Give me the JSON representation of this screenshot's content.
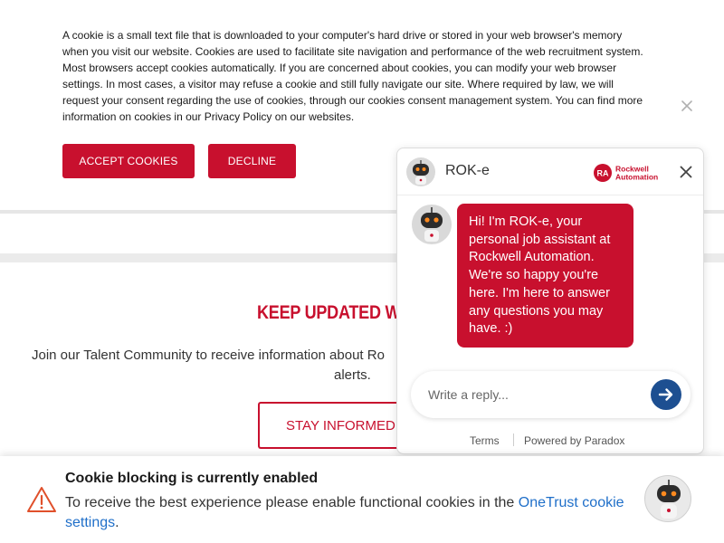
{
  "cookie_banner": {
    "text": "A cookie is a small text file that is downloaded to your computer's hard drive or stored in your web browser's memory when you visit our website. Cookies are used to facilitate site navigation and performance of the web recruitment system. Most browsers accept cookies automatically. If you are concerned about cookies, you can modify your web browser settings. In most cases, a visitor may refuse a cookie and still fully navigate our site. Where required by law, we will request your consent regarding the use of cookies, through our cookies consent management system. You can find more information on cookies in our Privacy Policy on our websites.",
    "accept_label": "ACCEPT COOKIES",
    "decline_label": "DECLINE",
    "close_icon": "close-icon"
  },
  "talent": {
    "title": "KEEP UPDATED W",
    "description_line1": "Join our Talent Community to receive information about Ro",
    "description_line2": "alerts.",
    "button_label": "STAY INFORMED N"
  },
  "chat": {
    "title": "ROK-e",
    "brand_line1": "Rockwell",
    "brand_line2": "Automation",
    "brand_badge": "RA",
    "message": "Hi! I'm ROK-e, your personal job assistant at Rockwell Automation. We're so happy you're here. I'm here to answer any questions you may have. :)",
    "reply_placeholder": "Write a reply...",
    "terms_label": "Terms",
    "powered_label": "Powered by Paradox",
    "accent_color": "#c8102e",
    "send_color": "#1d4f91"
  },
  "notice": {
    "title": "Cookie blocking is currently enabled",
    "body_prefix": "To receive the best experience please enable functional cookies in the ",
    "link_text": "OneTrust cookie settings",
    "body_suffix": ".",
    "icon": "warning-icon"
  }
}
